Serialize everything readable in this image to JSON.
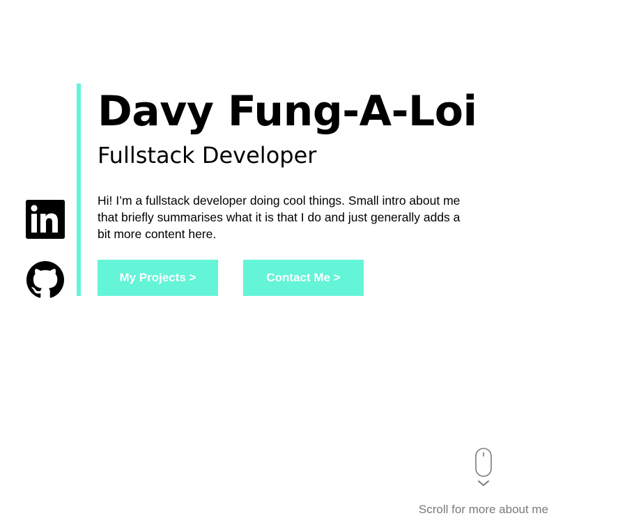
{
  "hero": {
    "name": "Davy Fung-A-Loi",
    "role": "Fullstack Developer",
    "intro": "Hi! I’m a fullstack developer doing cool things. Small intro about me that briefly summarises what it is that I do and just generally adds a bit more content here."
  },
  "buttons": {
    "projects_label": "My Projects >",
    "contact_label": "Contact Me >"
  },
  "social": {
    "linkedin_icon": "linkedin-icon",
    "github_icon": "github-icon"
  },
  "scroll": {
    "label": "Scroll for more about me",
    "icon": "mouse-icon"
  },
  "colors": {
    "accent": "#64f4d8",
    "text": "#000000",
    "muted": "#7a7a7a"
  }
}
